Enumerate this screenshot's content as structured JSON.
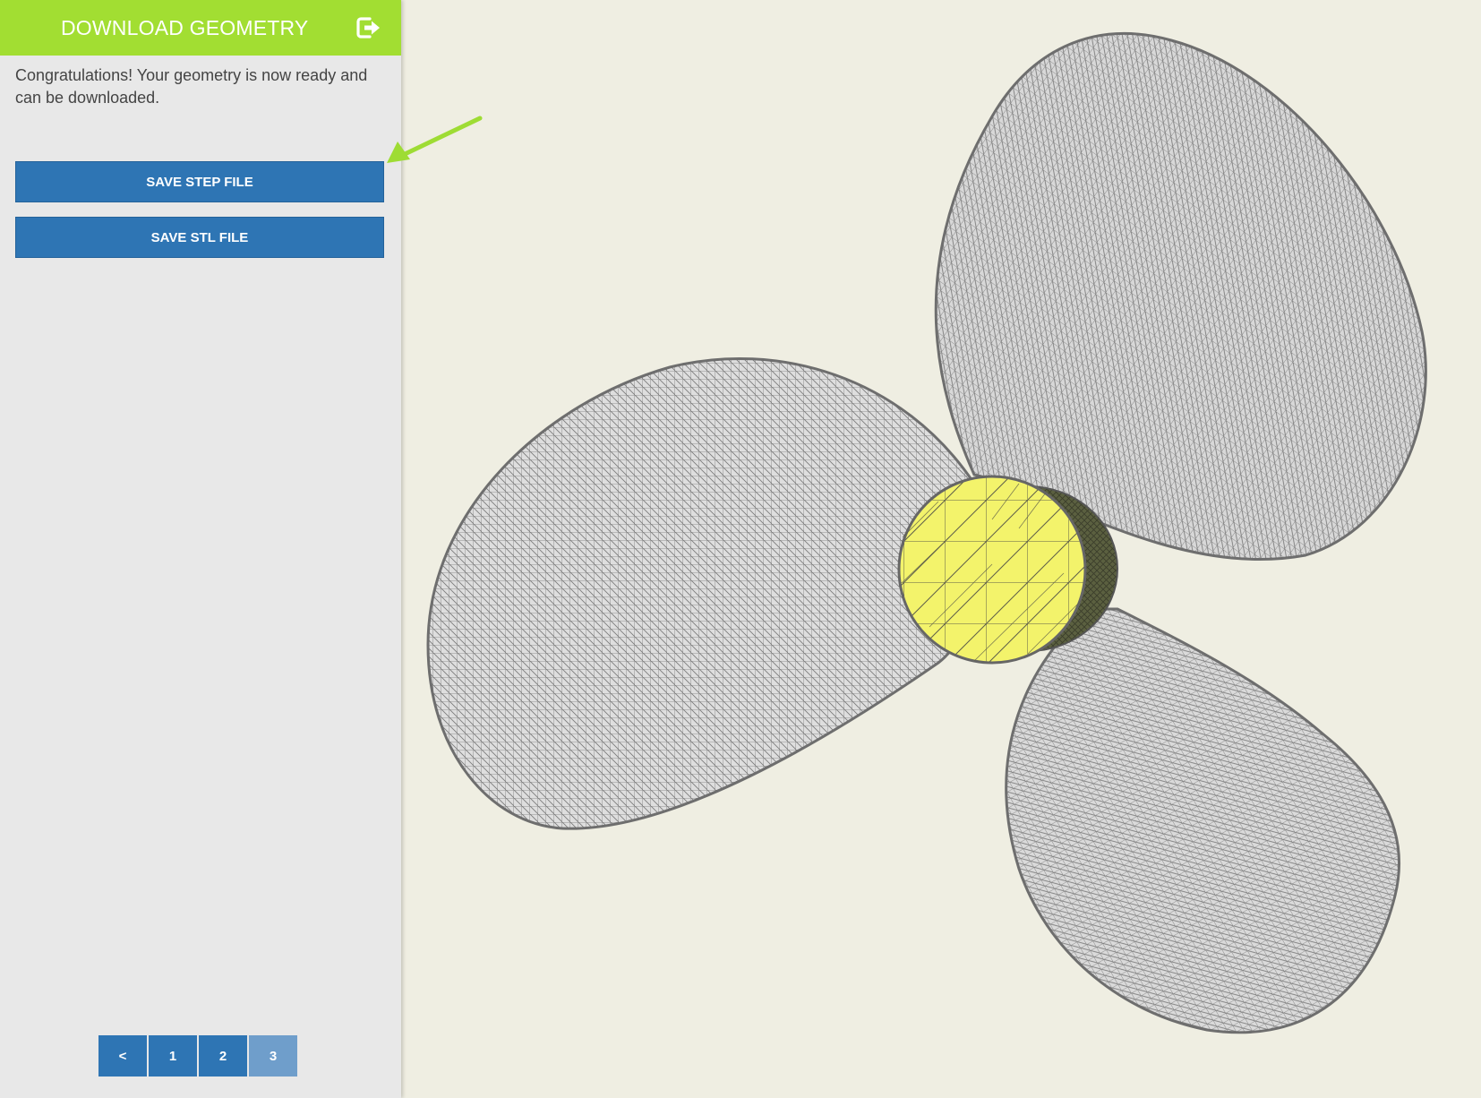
{
  "sidebar": {
    "title": "DOWNLOAD GEOMETRY",
    "exit_icon": "exit-icon",
    "message": "Congratulations! Your geometry is now ready and can be downloaded.",
    "buttons": {
      "save_step": "SAVE STEP FILE",
      "save_stl": "SAVE STL FILE"
    },
    "pagination": {
      "prev": "<",
      "pages": [
        "1",
        "2",
        "3"
      ],
      "active": "3"
    }
  },
  "colors": {
    "header": "#a2de32",
    "button": "#2e75b4",
    "button_active": "#6f9ecb",
    "panel": "#e8e8e8",
    "viewport": "#efeee2",
    "mesh": "#6f6f6f",
    "hub": "#f2f26a",
    "arrow": "#9edc34"
  },
  "viewport": {
    "model": "propeller-mesh",
    "blades": 3
  }
}
